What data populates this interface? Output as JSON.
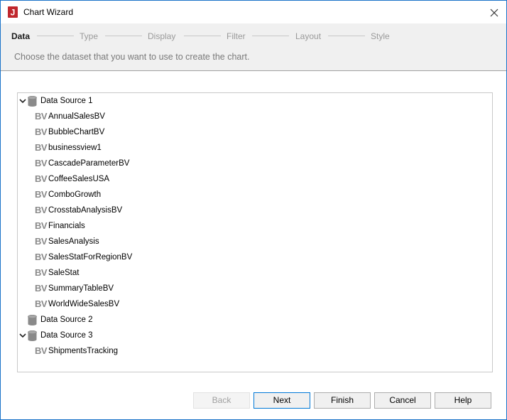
{
  "window": {
    "title": "Chart Wizard",
    "app_icon_letter": "J"
  },
  "steps": [
    {
      "label": "Data",
      "active": true
    },
    {
      "label": "Type",
      "active": false
    },
    {
      "label": "Display",
      "active": false
    },
    {
      "label": "Filter",
      "active": false
    },
    {
      "label": "Layout",
      "active": false
    },
    {
      "label": "Style",
      "active": false
    }
  ],
  "instruction": "Choose the dataset that you want to use to create the chart.",
  "tree": {
    "bv_icon_text": "BV",
    "sources": [
      {
        "label": "Data Source 1",
        "expanded": true,
        "items": [
          "AnnualSalesBV",
          "BubbleChartBV",
          "businessview1",
          "CascadeParameterBV",
          "CoffeeSalesUSA",
          "ComboGrowth",
          "CrosstabAnalysisBV",
          "Financials",
          "SalesAnalysis",
          "SalesStatForRegionBV",
          "SaleStat",
          "SummaryTableBV",
          "WorldWideSalesBV"
        ]
      },
      {
        "label": "Data Source 2",
        "expanded": false,
        "items": []
      },
      {
        "label": "Data Source 3",
        "expanded": true,
        "items": [
          "ShipmentsTracking"
        ]
      }
    ]
  },
  "buttons": {
    "back": "Back",
    "next": "Next",
    "finish": "Finish",
    "cancel": "Cancel",
    "help": "Help"
  },
  "colors": {
    "window_border": "#1a73c9",
    "app_icon": "#c0272d",
    "primary_button_border": "#0078d7"
  }
}
